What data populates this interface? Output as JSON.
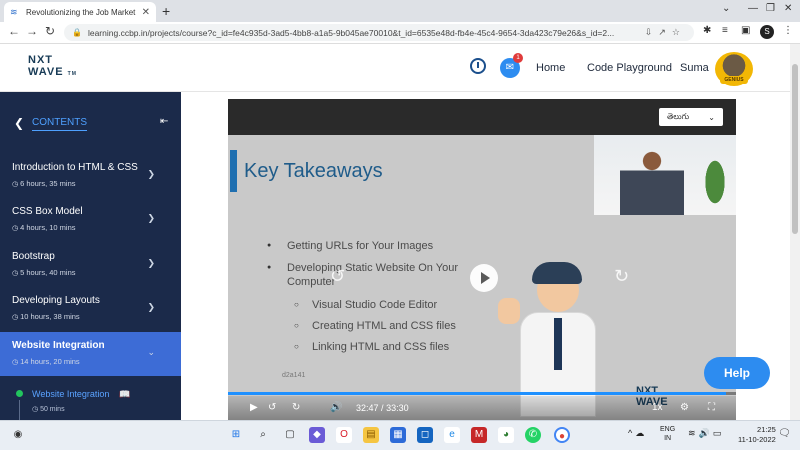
{
  "browser": {
    "tab_title": "Revolutionizing the Job Market |",
    "url": "learning.ccbp.in/projects/course?c_id=fe4c935d-3ad5-4bb8-a1a5-9b045ae70010&t_id=6535e48d-fb4e-45c4-9654-3da423c79e26&s_id=2...",
    "profile_initial": "S"
  },
  "header": {
    "logo_line1": "NXT",
    "logo_line2": "WAVE",
    "logo_tm": "TM",
    "chat_badge": "1",
    "nav": [
      "Home",
      "Code Playground",
      "Suma"
    ],
    "badge_label": "GENIUS"
  },
  "sidebar": {
    "title": "CONTENTS",
    "modules": [
      {
        "name": "Introduction to HTML & CSS",
        "duration": "6 hours, 35 mins"
      },
      {
        "name": "CSS Box Model",
        "duration": "4 hours, 10 mins"
      },
      {
        "name": "Bootstrap",
        "duration": "5 hours, 40 mins"
      },
      {
        "name": "Developing Layouts",
        "duration": "10 hours, 38 mins"
      },
      {
        "name": "Website Integration",
        "duration": "14 hours, 20 mins",
        "active": true
      }
    ],
    "sub_item": {
      "name": "Website Integration",
      "duration": "50 mins"
    }
  },
  "video": {
    "language": "తెలుగు",
    "slide_title": "Key Takeaways",
    "bullets": [
      {
        "text": "Getting URLs for Your Images",
        "level": 1
      },
      {
        "text": "Developing Static Website On Your",
        "level": 1
      },
      {
        "text": "Computer",
        "level": 0
      },
      {
        "text": "Visual Studio Code Editor",
        "level": 2
      },
      {
        "text": "Creating HTML and CSS files",
        "level": 2
      },
      {
        "text": "Linking HTML and CSS files",
        "level": 2
      }
    ],
    "watermark": "d2a141",
    "seek_back_label": "10",
    "seek_fwd_label": "10",
    "time_current": "32:47",
    "time_separator": "/",
    "time_total": "33:30",
    "progress": 0.98,
    "speed": "1x"
  },
  "help_label": "Help",
  "taskbar": {
    "lang_line1": "ENG",
    "lang_line2": "IN",
    "time": "21:25",
    "date": "11-10-2022"
  },
  "colors": {
    "sidebar_bg": "#1b2a4a",
    "active_module": "#3d6cd6",
    "accent": "#2d8cf0"
  }
}
